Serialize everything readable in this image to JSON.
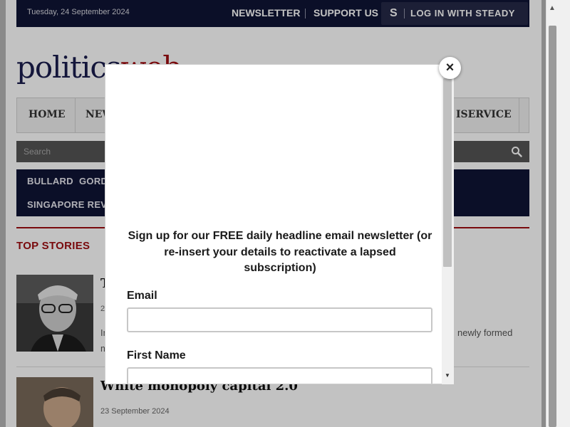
{
  "topbar": {
    "date": "Tuesday, 24 September 2024",
    "newsletter": "NEWSLETTER",
    "support": "SUPPORT US",
    "steady_icon": "S",
    "login": "LOG IN WITH STEADY"
  },
  "logo": {
    "part1": "politics",
    "part2": "web"
  },
  "nav": {
    "items": [
      "HOME",
      "NEW",
      "ISERVICE"
    ]
  },
  "search": {
    "placeholder": "Search"
  },
  "tags": [
    "BULLARD",
    "GORD",
    "SINGAPORE REV"
  ],
  "top_stories": {
    "heading": "TOP STORIES",
    "story1": {
      "title_fragment": "T",
      "date_fragment": "2",
      "text_fragment": "In",
      "text_fragment2": "m",
      "text_right": "newly formed"
    },
    "story2": {
      "title": "White monopoly capital 2.0",
      "date": "23 September 2024"
    }
  },
  "modal": {
    "heading": "Sign up for our FREE daily headline email newsletter (or re-insert your details to reactivate a lapsed subscription)",
    "email_label": "Email",
    "first_name_label": "First Name",
    "close_icon": "×"
  },
  "colors": {
    "navy": "#0f1535",
    "brand_red": "#9f0e12"
  }
}
